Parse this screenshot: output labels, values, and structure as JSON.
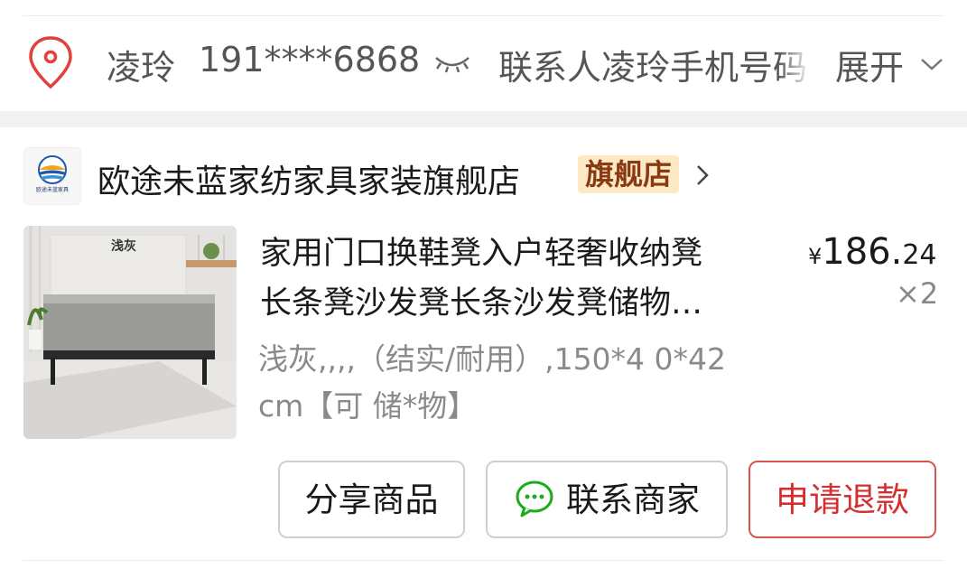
{
  "address": {
    "name": "凌玲",
    "phone": "191****6868",
    "description": "联系人凌玲手机号码",
    "expand_label": "展开",
    "pin_color": "#e0413c"
  },
  "shop": {
    "name": "欧途未蓝家纺家具家装旗舰店",
    "badge": "旗舰店",
    "logo_text": "欧途未蓝家具"
  },
  "product": {
    "image_label": "浅灰",
    "title_line1": "家用门口换鞋凳入户轻奢收纳凳",
    "title_line2": "长条凳沙发凳长条沙发凳储物…",
    "price_currency": "¥",
    "price_integer": "186.",
    "price_decimal": "24",
    "quantity": "×2",
    "spec_line1": "浅灰,,,,（结实/耐用）,150*4 0*42",
    "spec_line2": "cm【可 储*物】"
  },
  "actions": {
    "share_label": "分享商品",
    "contact_label": "联系商家",
    "refund_label": "申请退款",
    "refund_color": "#d32f2f"
  }
}
